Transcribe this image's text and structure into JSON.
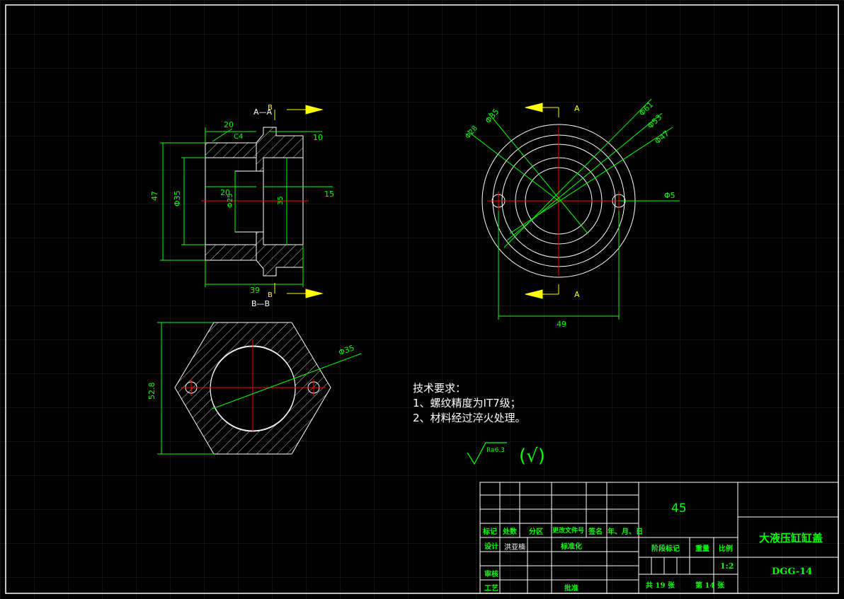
{
  "views": {
    "section_top_label": "A—A",
    "section_bottom_label": "B—B",
    "cut_a": "A",
    "cut_b": "B"
  },
  "dimensions": {
    "d20_top": "20",
    "c4": "C4",
    "d10": "10",
    "d47": "47",
    "d35_left": "Φ35",
    "d20_mid": "20",
    "d25_mid": "Φ25",
    "d35_right": "35",
    "d15": "15",
    "d39": "39",
    "phi35_top": "Φ35",
    "phi28": "Φ28",
    "phi61": "Φ61",
    "phi53": "Φ53",
    "phi47": "Φ47",
    "phi5": "Φ5",
    "d49": "49",
    "d52_8": "52.8",
    "phi35_hex": "Φ35"
  },
  "technical_requirements": {
    "title": "技术要求：",
    "item1": "1、螺纹精度为IT7级；",
    "item2": "2、材料经过淬火处理。"
  },
  "surface_finish": {
    "ra": "Ra6.3",
    "symbol": "(√)"
  },
  "title_block": {
    "material": "45",
    "part_name": "大液压缸缸盖",
    "drawing_no": "DGG-14",
    "headers": {
      "mark": "标记",
      "count": "处数",
      "zone": "分区",
      "change_doc": "更改文件号",
      "signature": "签名",
      "date": "年、月、日",
      "design": "设计",
      "standardize": "标准化",
      "stage_mark": "阶段标记",
      "weight": "重量",
      "scale": "比例",
      "review": "审核",
      "process": "工艺",
      "approve": "批准"
    },
    "designer": "洪亚楠",
    "scale": "1:2",
    "total_label": "共 19 张",
    "sheet_label": "第 14 张"
  },
  "colors": {
    "background": "#000000",
    "outline": "#ffffff",
    "dimension": "#00ff00",
    "centerline": "#ff0000",
    "arrow": "#ffff00",
    "grid": "#2a2a2a"
  }
}
